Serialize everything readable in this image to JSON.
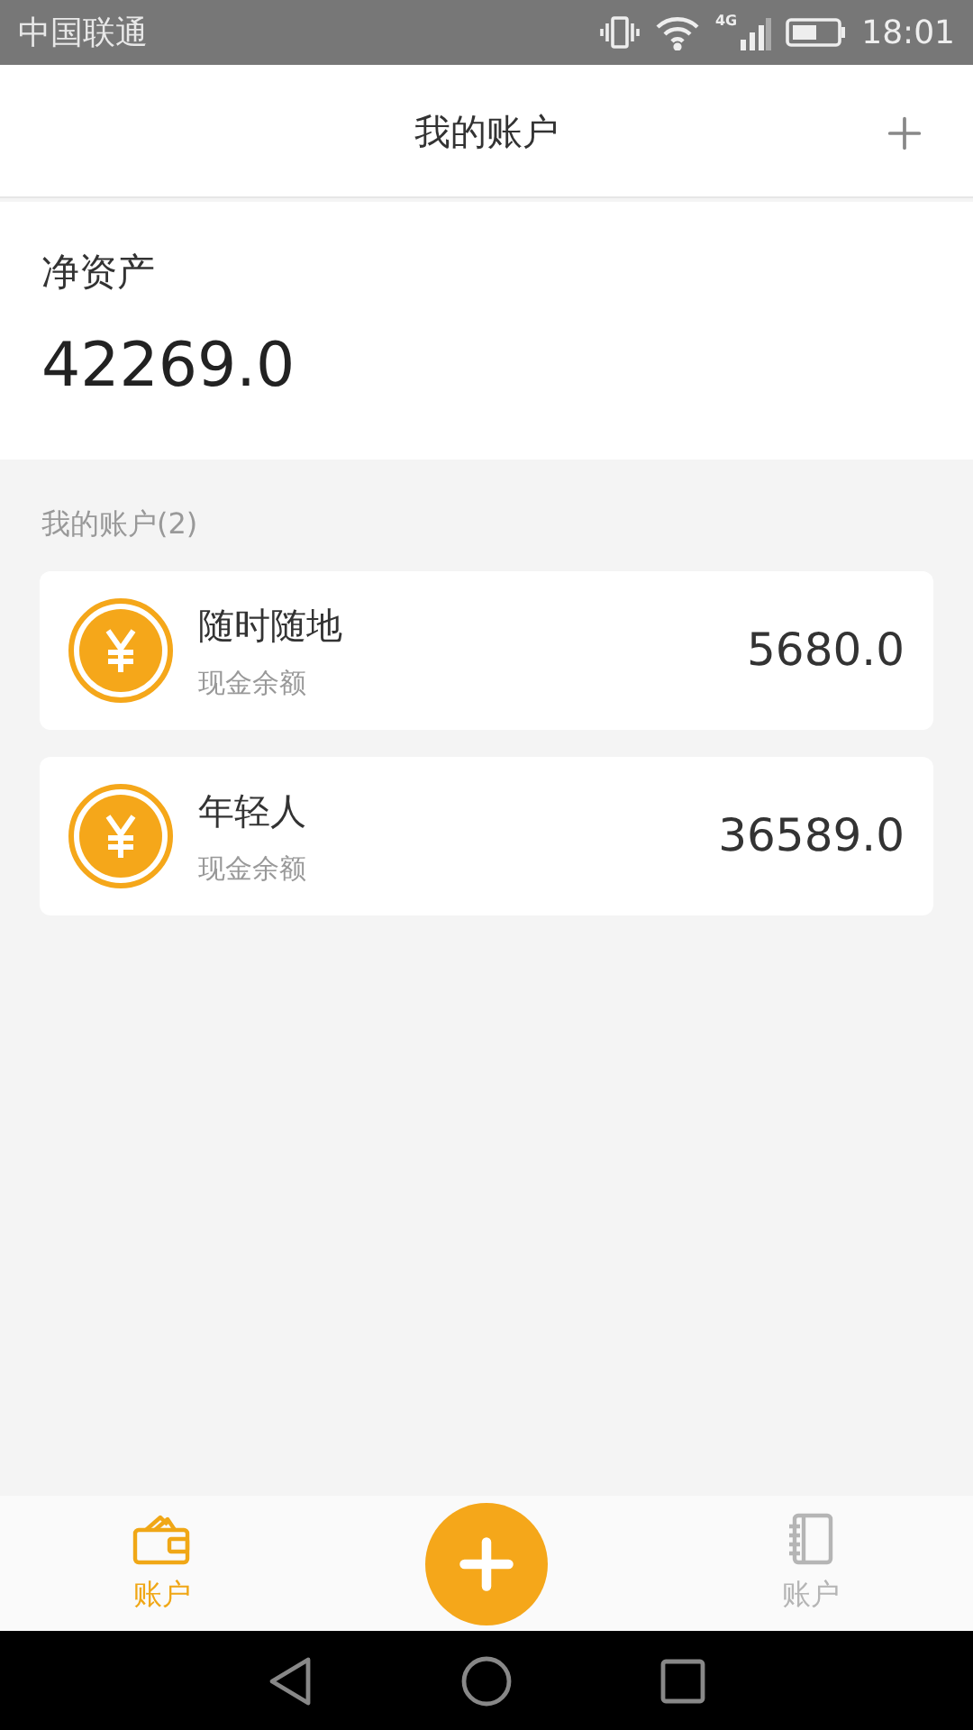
{
  "status_bar": {
    "carrier": "中国联通",
    "time": "18:01",
    "network": "4G"
  },
  "header": {
    "title": "我的账户"
  },
  "net_assets": {
    "label": "净资产",
    "value": "42269.0"
  },
  "accounts_section": {
    "label": "我的账户(2)"
  },
  "accounts": [
    {
      "name": "随时随地",
      "type": "现金余额",
      "balance": "5680.0"
    },
    {
      "name": "年轻人",
      "type": "现金余额",
      "balance": "36589.0"
    }
  ],
  "tabs": [
    {
      "label": "账户",
      "kind": "wallet",
      "selected": true
    },
    {
      "label": "账户",
      "kind": "notebook",
      "selected": false
    }
  ]
}
